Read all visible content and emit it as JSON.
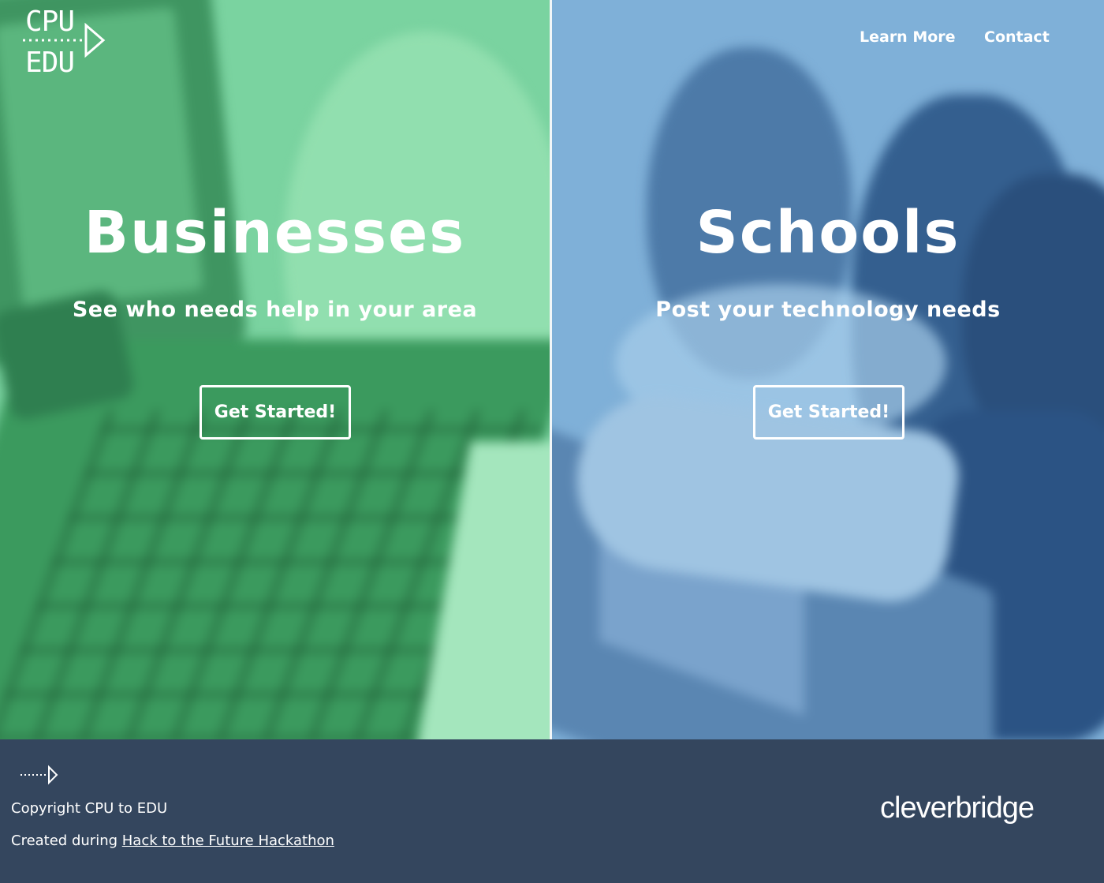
{
  "logo": {
    "line1": "CPU",
    "line2": "EDU"
  },
  "nav": {
    "learn_more": "Learn More",
    "contact": "Contact"
  },
  "businesses": {
    "title": "Businesses",
    "subtitle": "See who needs help in your area",
    "cta": "Get Started!"
  },
  "schools": {
    "title": "Schools",
    "subtitle": "Post your technology needs",
    "cta": "Get Started!"
  },
  "footer": {
    "copyright": "Copyright CPU to EDU",
    "created_prefix": "Created during ",
    "hackathon_link": "Hack to the Future Hackathon",
    "sponsor": "cleverbridge"
  },
  "colors": {
    "businesses_tint": "#7ad3a0",
    "schools_tint": "#7fb0d8",
    "footer_bg": "#34465e"
  }
}
